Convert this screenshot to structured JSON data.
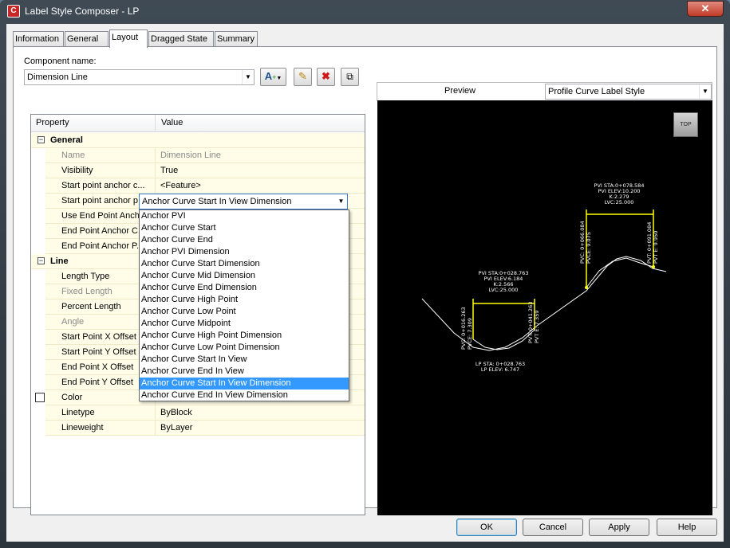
{
  "window": {
    "title": "Label Style Composer - LP",
    "close_label": "✕"
  },
  "tabs": [
    "Information",
    "General",
    "Layout",
    "Dragged State",
    "Summary"
  ],
  "component": {
    "label": "Component name:",
    "value": "Dimension Line"
  },
  "grid": {
    "col_property": "Property",
    "col_value": "Value",
    "rows": [
      {
        "type": "cat",
        "name": "General",
        "value": ""
      },
      {
        "type": "dis",
        "name": "Name",
        "value": "Dimension Line"
      },
      {
        "type": "prop",
        "name": "Visibility",
        "value": "True"
      },
      {
        "type": "prop",
        "name": "Start point anchor c...",
        "value": "<Feature>"
      },
      {
        "type": "prop",
        "name": "Start point anchor p...",
        "value": ""
      },
      {
        "type": "prop",
        "name": "Use End Point Anchor",
        "value": ""
      },
      {
        "type": "prop",
        "name": "End Point Anchor C...",
        "value": ""
      },
      {
        "type": "prop",
        "name": "End Point Anchor P...",
        "value": ""
      },
      {
        "type": "cat",
        "name": "Line",
        "value": ""
      },
      {
        "type": "prop",
        "name": "Length Type",
        "value": ""
      },
      {
        "type": "dis",
        "name": "Fixed Length",
        "value": ""
      },
      {
        "type": "prop",
        "name": "Percent Length",
        "value": ""
      },
      {
        "type": "dis",
        "name": "Angle",
        "value": ""
      },
      {
        "type": "prop",
        "name": "Start Point X Offset",
        "value": ""
      },
      {
        "type": "prop",
        "name": "Start Point Y Offset",
        "value": ""
      },
      {
        "type": "prop",
        "name": "End Point X Offset",
        "value": ""
      },
      {
        "type": "prop",
        "name": "End Point Y Offset",
        "value": ""
      },
      {
        "type": "color",
        "name": "Color",
        "value": ""
      },
      {
        "type": "prop",
        "name": "Linetype",
        "value": "ByBlock"
      },
      {
        "type": "prop",
        "name": "Lineweight",
        "value": "ByLayer"
      }
    ]
  },
  "dropdown": {
    "current": "Anchor Curve Start In View Dimension",
    "selected_index": 14,
    "options": [
      "Anchor PVI",
      "Anchor Curve Start",
      "Anchor Curve End",
      "Anchor PVI Dimension",
      "Anchor Curve Start Dimension",
      "Anchor Curve Mid Dimension",
      "Anchor Curve End Dimension",
      "Anchor Curve High Point",
      "Anchor Curve Low Point",
      "Anchor Curve Midpoint",
      "Anchor Curve High Point Dimension",
      "Anchor Curve Low Point Dimension",
      "Anchor Curve Start In View",
      "Anchor Curve End In View",
      "Anchor Curve Start In View Dimension",
      "Anchor Curve End In View Dimension"
    ]
  },
  "preview": {
    "label": "Preview",
    "style_value": "Profile Curve Label Style",
    "top_label": "TOP",
    "crest": {
      "sta": "PVI STA:0+078.584",
      "elev": "PVI ELEV:10.200",
      "k": "K:2.279",
      "lvc": "LVC:25.000",
      "pvc_sta": "PVC: 0+066.084",
      "pvc_elev": "PVCE: 9.075",
      "pvt_sta": "PVT: 0+091.084",
      "pvt_elev": "PVT E: 9.950"
    },
    "sag": {
      "sta": "PVI STA:0+028.763",
      "elev": "PVI ELEV:6.184",
      "k": "K:2.566",
      "lvc": "LVC:25.000",
      "pvc_sta": "PVC: 0+016.263",
      "pvc_elev": "PVCE: 7.309",
      "pvt_sta": "PVT: 0+041.263",
      "pvt_elev": "PVT E: 7.359",
      "lp_sta": "LP STA: 0+028.763",
      "lp_elev": "LP ELEV: 6.747"
    }
  },
  "buttons": {
    "ok": "OK",
    "cancel": "Cancel",
    "apply": "Apply",
    "help": "Help"
  }
}
